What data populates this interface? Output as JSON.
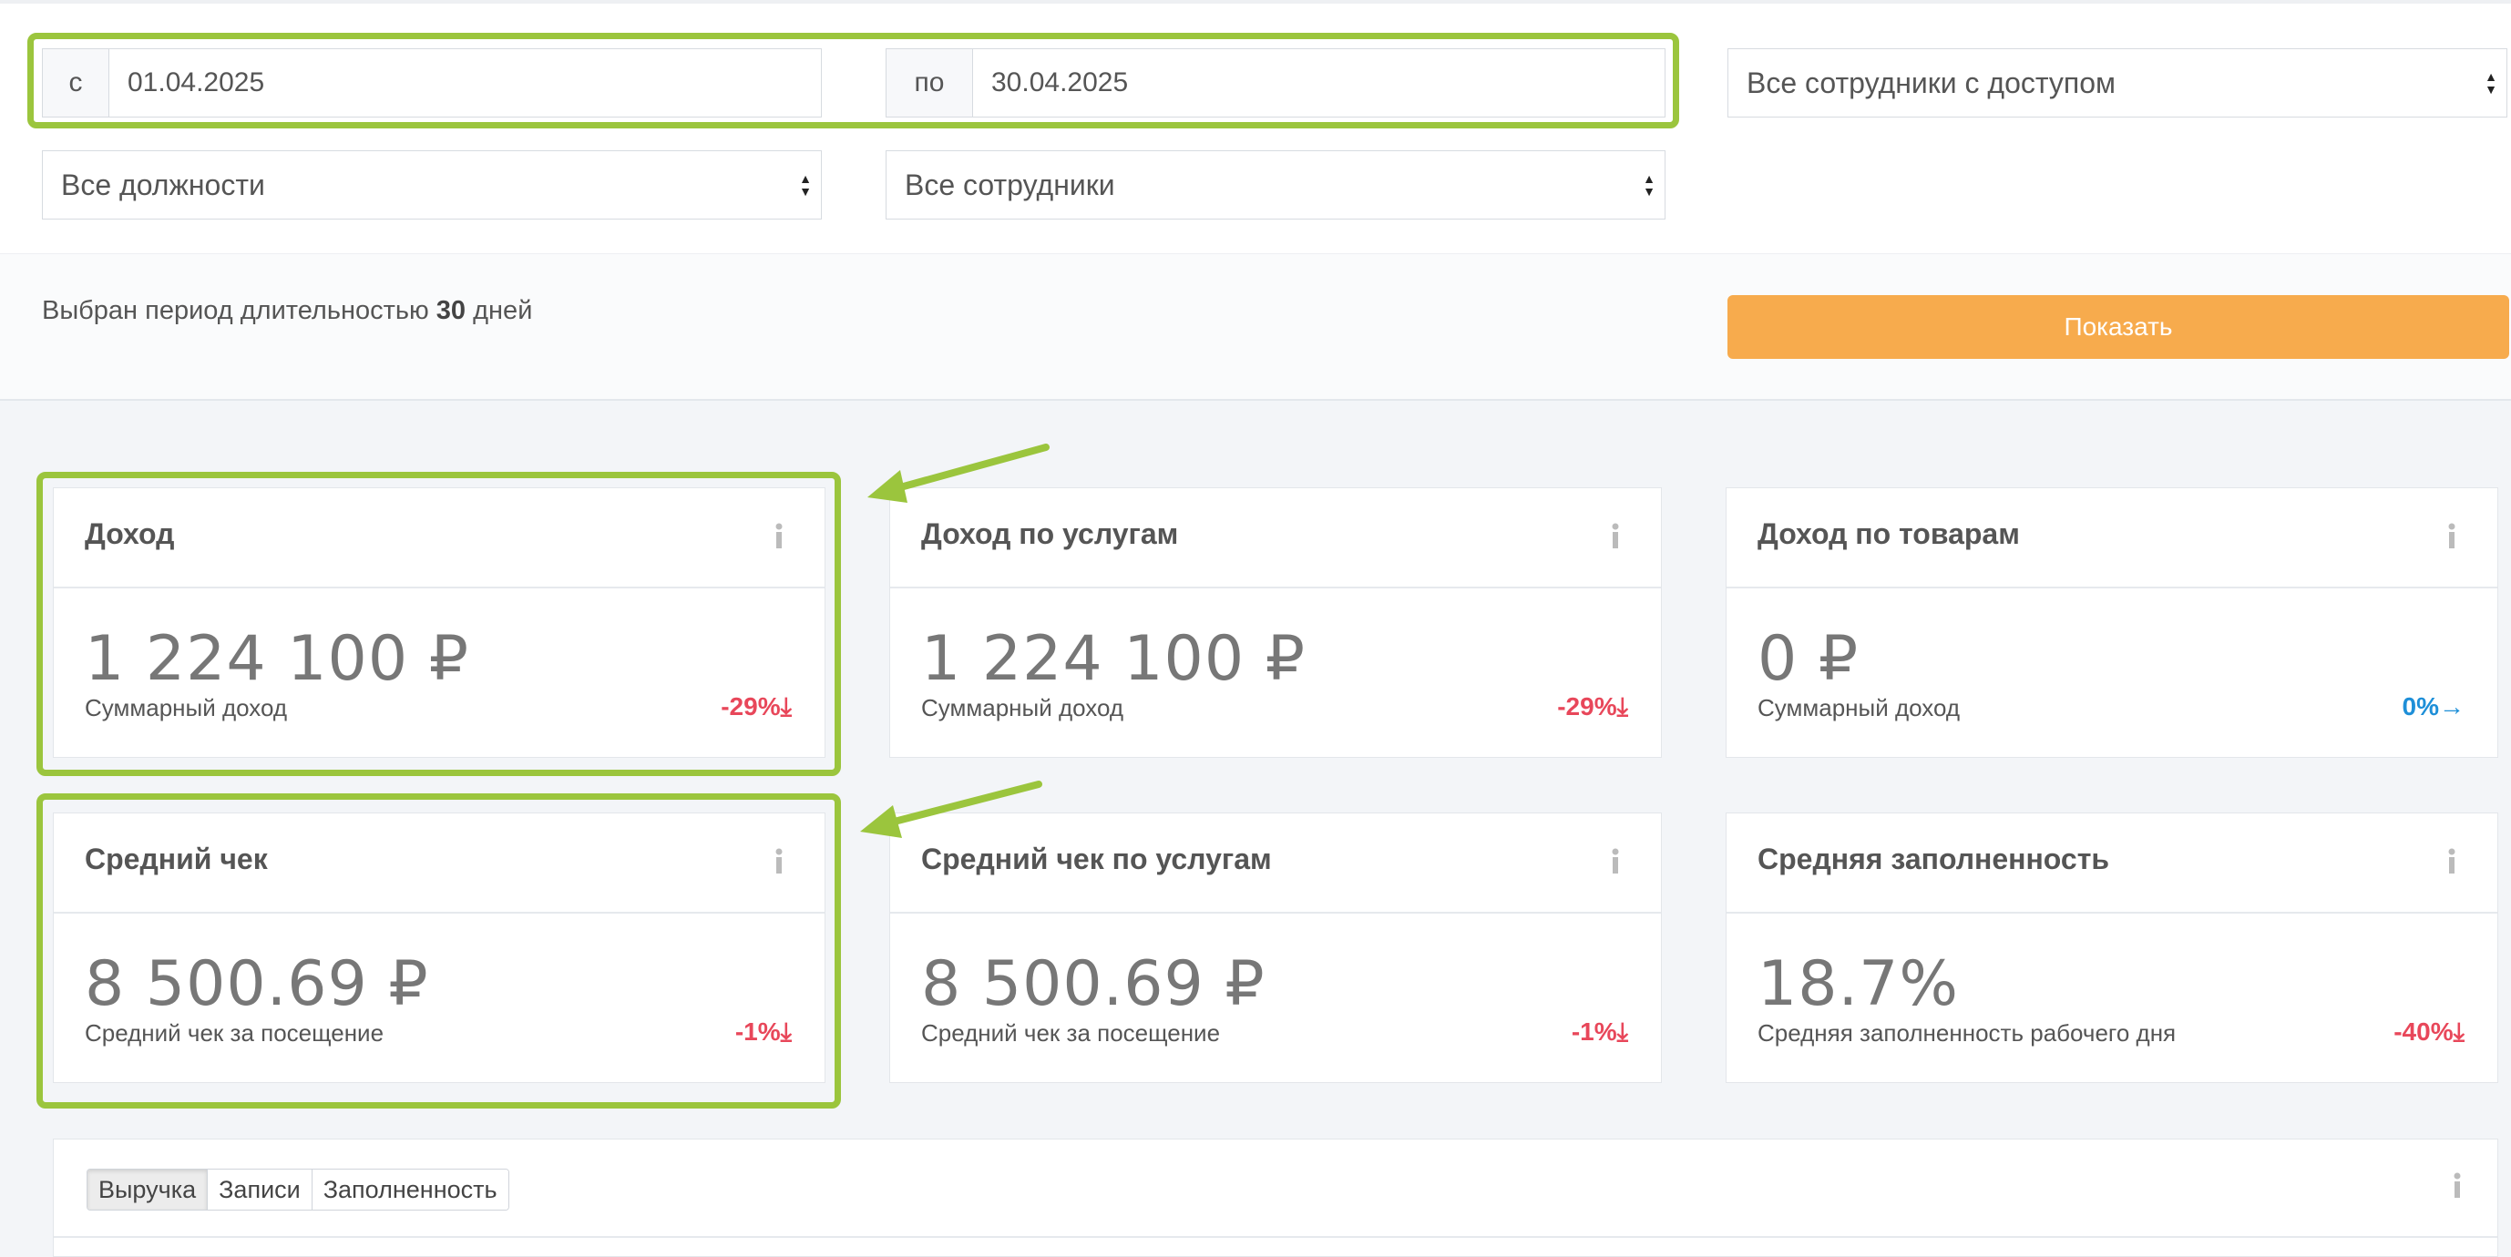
{
  "filters": {
    "from_label": "с",
    "from_value": "01.04.2025",
    "to_label": "по",
    "to_value": "30.04.2025",
    "staff_access_select": "Все сотрудники с доступом",
    "positions_select": "Все должности",
    "employees_select": "Все сотрудники"
  },
  "summary": {
    "period_prefix": "Выбран период длительностью",
    "period_days": "30",
    "period_suffix": "дней",
    "show_button": "Показать"
  },
  "cards": [
    {
      "title": "Доход",
      "value": "1 224 100 ₽",
      "caption": "Суммарный доход",
      "change": "-29%",
      "trend": "down"
    },
    {
      "title": "Доход по услугам",
      "value": "1 224 100 ₽",
      "caption": "Суммарный доход",
      "change": "-29%",
      "trend": "down"
    },
    {
      "title": "Доход по товарам",
      "value": "0 ₽",
      "caption": "Суммарный доход",
      "change": "0%",
      "trend": "flat"
    },
    {
      "title": "Средний чек",
      "value": "8 500.69 ₽",
      "caption": "Средний чек за посещение",
      "change": "-1%",
      "trend": "down"
    },
    {
      "title": "Средний чек по услугам",
      "value": "8 500.69 ₽",
      "caption": "Средний чек за посещение",
      "change": "-1%",
      "trend": "down"
    },
    {
      "title": "Средняя заполненность",
      "value": "18.7%",
      "caption": "Средняя заполненность рабочего дня",
      "change": "-40%",
      "trend": "down"
    }
  ],
  "chart_tabs": [
    "Выручка",
    "Записи",
    "Заполненность"
  ],
  "colors": {
    "highlight": "#9bc53d",
    "accent_button": "#f7ab4d",
    "negative": "#e8475a",
    "neutral": "#1e8fd8"
  },
  "icons": {
    "info": "info-icon",
    "down_arrow": "arrow-down-icon",
    "right_arrow": "arrow-right-icon",
    "select": "select-arrows-icon"
  }
}
